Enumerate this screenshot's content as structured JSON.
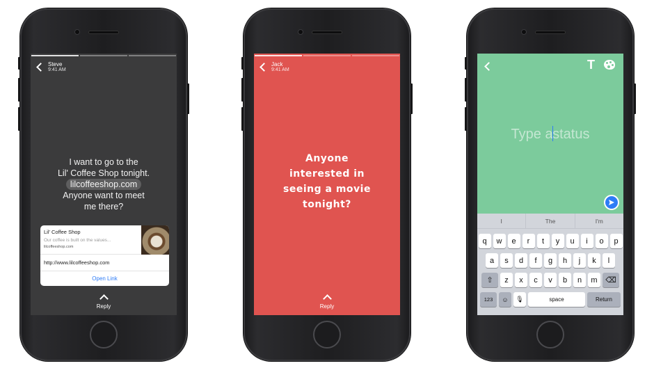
{
  "phone1": {
    "progress": [
      true,
      false,
      false
    ],
    "sender": "Steve",
    "time": "9:41 AM",
    "message_line1": "I want to go to the",
    "message_line2": "Lil' Coffee Shop tonight.",
    "message_link": "lilcoffeeshop.com",
    "message_line3": "Anyone want to meet",
    "message_line4": "me there?",
    "card": {
      "title": "Lil' Coffee Shop",
      "description": "Our coffee is built on the values...",
      "domain": "lilcoffeeshop.com",
      "url": "http://www.lilcoffeeshop.com",
      "action": "Open Link"
    },
    "reply": "Reply"
  },
  "phone2": {
    "progress": [
      true,
      false,
      false
    ],
    "sender": "Jack",
    "time": "9:41 AM",
    "message_line1": "Anyone",
    "message_line2": "interested in",
    "message_line3": "seeing a movie",
    "message_line4": "tonight?",
    "reply": "Reply",
    "color": "#e05450"
  },
  "phone3": {
    "text_tool": "T",
    "status_before": "Type a",
    "status_after": "status",
    "suggestions": [
      "I",
      "The",
      "I'm"
    ],
    "row1": [
      "q",
      "w",
      "e",
      "r",
      "t",
      "y",
      "u",
      "i",
      "o",
      "p"
    ],
    "row2": [
      "a",
      "s",
      "d",
      "f",
      "g",
      "h",
      "j",
      "k",
      "l"
    ],
    "row3": [
      "z",
      "x",
      "c",
      "v",
      "b",
      "n",
      "m"
    ],
    "key_123": "123",
    "key_space": "space",
    "key_return": "Return",
    "color": "#7ccb9c"
  }
}
